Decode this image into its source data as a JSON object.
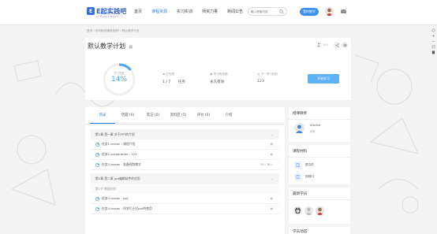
{
  "header": {
    "logo_text": "E起实践吧",
    "logo_sub": "17 Practice Project",
    "nav": [
      "首页",
      "课程资源",
      "实习实训",
      "师资力量",
      "新闻公告"
    ],
    "search_placeholder": "输入搜索内容",
    "my_teaching": "我的教学"
  },
  "breadcrumb": "首页  /  如何制作课程视频?  /  默认教学计划",
  "plan": {
    "title": "默认教学计划",
    "student_count": "0人",
    "progress_label": "学习进度",
    "progress_value": "14%",
    "progress_fraction": 0.14,
    "stats": [
      {
        "label": "已完成",
        "value": "1 / 7",
        "unit": "任务"
      },
      {
        "label": "学习有效期",
        "value": "永久有效",
        "unit": ""
      },
      {
        "label": "下一学习任务",
        "value": "123",
        "unit": ""
      }
    ],
    "study_button": "开始学习"
  },
  "tabs": [
    "目录",
    "话题 (0)",
    "笔记 (0)",
    "资料区 (5)",
    "评价 (0)",
    "介绍"
  ],
  "catalog": [
    {
      "kind": "chapter",
      "text": "第1章 第一章 关于PPT的介绍",
      "end": "⌄"
    },
    {
      "kind": "task",
      "text": "任务1-lesson : 课程介绍",
      "end": "▤"
    },
    {
      "kind": "task",
      "text": "任务1-preparation : 123",
      "end": "▤"
    },
    {
      "kind": "task",
      "text": "任务2-lesson : 准备视频教学",
      "end": "00 : 18 ▷"
    },
    {
      "kind": "chapter",
      "text": "第2章 第二章 ppt编辑软件的应用",
      "end": "⌄"
    },
    {
      "kind": "unit",
      "text": "第1节 数据创作",
      "end": ""
    },
    {
      "kind": "task",
      "text": "任务3-lesson : ppt",
      "end": "▤"
    },
    {
      "kind": "task",
      "text": "任务4-lesson : 四学们士们ppt的使用",
      "end": "▤"
    }
  ],
  "sidebar": {
    "teacher_title": "授课教师",
    "teacher_name": "teacher",
    "teacher_sub": "助教",
    "files_title": "课程材料",
    "files": [
      "图文的",
      "视频01"
    ],
    "students_title": "最新学员",
    "activity_title": "学员动态"
  },
  "colors": {
    "accent": "#2f7de1",
    "button": "#5fb1f5",
    "progress": "#4aa6f5"
  }
}
